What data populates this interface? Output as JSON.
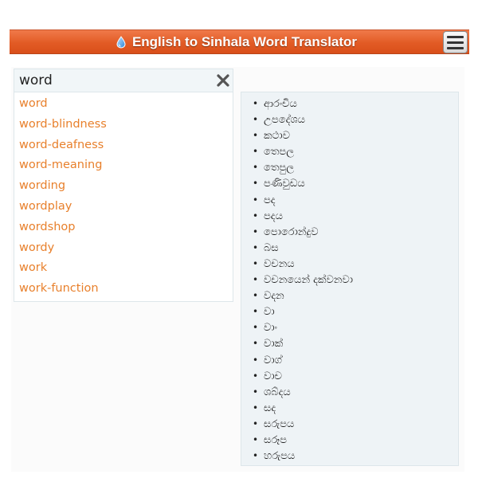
{
  "header": {
    "title": "English to Sinhala Word Translator",
    "logo_icon": "water-drop-icon",
    "menu_icon": "hamburger-menu-icon"
  },
  "search": {
    "value": "word",
    "placeholder": "",
    "clear_icon": "close-icon"
  },
  "suggestions": [
    "word",
    "word-blindness",
    "word-deafness",
    "word-meaning",
    "wording",
    "wordplay",
    "wordshop",
    "wordy",
    "work",
    "work-function"
  ],
  "results": [
    "ආරංචිය",
    "උපදේශය",
    "කථාව",
    "තෙපල",
    "තෙපුල",
    "පණිවුඩය",
    "පද",
    "පදය",
    "පොරොන්දුව",
    "බස",
    "වචනය",
    "වචනයෙන් දක්වනවා",
    "වදන",
    "වා",
    "වාං",
    "වාක්",
    "වාග්",
    "වාච",
    "ශබ්දය",
    "සද",
    "සරුපය",
    "සරූප",
    "හරුපය"
  ],
  "colors": {
    "header_bg": "#e25b25",
    "link": "#e8802c",
    "results_bg": "#eef3f6",
    "search_bg": "#f1f6f8"
  }
}
